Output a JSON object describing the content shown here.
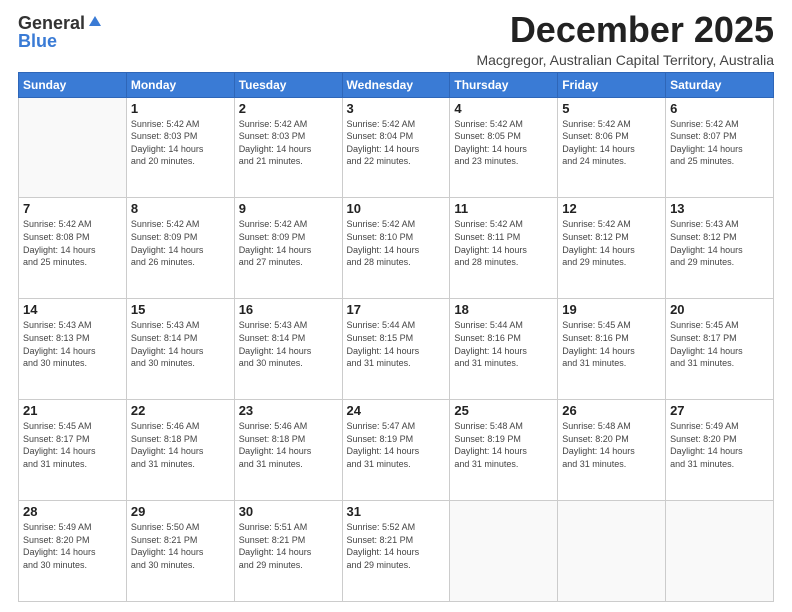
{
  "logo": {
    "general": "General",
    "blue": "Blue"
  },
  "title": "December 2025",
  "subtitle": "Macgregor, Australian Capital Territory, Australia",
  "days_header": [
    "Sunday",
    "Monday",
    "Tuesday",
    "Wednesday",
    "Thursday",
    "Friday",
    "Saturday"
  ],
  "weeks": [
    [
      {
        "num": "",
        "info": ""
      },
      {
        "num": "1",
        "info": "Sunrise: 5:42 AM\nSunset: 8:03 PM\nDaylight: 14 hours\nand 20 minutes."
      },
      {
        "num": "2",
        "info": "Sunrise: 5:42 AM\nSunset: 8:03 PM\nDaylight: 14 hours\nand 21 minutes."
      },
      {
        "num": "3",
        "info": "Sunrise: 5:42 AM\nSunset: 8:04 PM\nDaylight: 14 hours\nand 22 minutes."
      },
      {
        "num": "4",
        "info": "Sunrise: 5:42 AM\nSunset: 8:05 PM\nDaylight: 14 hours\nand 23 minutes."
      },
      {
        "num": "5",
        "info": "Sunrise: 5:42 AM\nSunset: 8:06 PM\nDaylight: 14 hours\nand 24 minutes."
      },
      {
        "num": "6",
        "info": "Sunrise: 5:42 AM\nSunset: 8:07 PM\nDaylight: 14 hours\nand 25 minutes."
      }
    ],
    [
      {
        "num": "7",
        "info": "Sunrise: 5:42 AM\nSunset: 8:08 PM\nDaylight: 14 hours\nand 25 minutes."
      },
      {
        "num": "8",
        "info": "Sunrise: 5:42 AM\nSunset: 8:09 PM\nDaylight: 14 hours\nand 26 minutes."
      },
      {
        "num": "9",
        "info": "Sunrise: 5:42 AM\nSunset: 8:09 PM\nDaylight: 14 hours\nand 27 minutes."
      },
      {
        "num": "10",
        "info": "Sunrise: 5:42 AM\nSunset: 8:10 PM\nDaylight: 14 hours\nand 28 minutes."
      },
      {
        "num": "11",
        "info": "Sunrise: 5:42 AM\nSunset: 8:11 PM\nDaylight: 14 hours\nand 28 minutes."
      },
      {
        "num": "12",
        "info": "Sunrise: 5:42 AM\nSunset: 8:12 PM\nDaylight: 14 hours\nand 29 minutes."
      },
      {
        "num": "13",
        "info": "Sunrise: 5:43 AM\nSunset: 8:12 PM\nDaylight: 14 hours\nand 29 minutes."
      }
    ],
    [
      {
        "num": "14",
        "info": "Sunrise: 5:43 AM\nSunset: 8:13 PM\nDaylight: 14 hours\nand 30 minutes."
      },
      {
        "num": "15",
        "info": "Sunrise: 5:43 AM\nSunset: 8:14 PM\nDaylight: 14 hours\nand 30 minutes."
      },
      {
        "num": "16",
        "info": "Sunrise: 5:43 AM\nSunset: 8:14 PM\nDaylight: 14 hours\nand 30 minutes."
      },
      {
        "num": "17",
        "info": "Sunrise: 5:44 AM\nSunset: 8:15 PM\nDaylight: 14 hours\nand 31 minutes."
      },
      {
        "num": "18",
        "info": "Sunrise: 5:44 AM\nSunset: 8:16 PM\nDaylight: 14 hours\nand 31 minutes."
      },
      {
        "num": "19",
        "info": "Sunrise: 5:45 AM\nSunset: 8:16 PM\nDaylight: 14 hours\nand 31 minutes."
      },
      {
        "num": "20",
        "info": "Sunrise: 5:45 AM\nSunset: 8:17 PM\nDaylight: 14 hours\nand 31 minutes."
      }
    ],
    [
      {
        "num": "21",
        "info": "Sunrise: 5:45 AM\nSunset: 8:17 PM\nDaylight: 14 hours\nand 31 minutes."
      },
      {
        "num": "22",
        "info": "Sunrise: 5:46 AM\nSunset: 8:18 PM\nDaylight: 14 hours\nand 31 minutes."
      },
      {
        "num": "23",
        "info": "Sunrise: 5:46 AM\nSunset: 8:18 PM\nDaylight: 14 hours\nand 31 minutes."
      },
      {
        "num": "24",
        "info": "Sunrise: 5:47 AM\nSunset: 8:19 PM\nDaylight: 14 hours\nand 31 minutes."
      },
      {
        "num": "25",
        "info": "Sunrise: 5:48 AM\nSunset: 8:19 PM\nDaylight: 14 hours\nand 31 minutes."
      },
      {
        "num": "26",
        "info": "Sunrise: 5:48 AM\nSunset: 8:20 PM\nDaylight: 14 hours\nand 31 minutes."
      },
      {
        "num": "27",
        "info": "Sunrise: 5:49 AM\nSunset: 8:20 PM\nDaylight: 14 hours\nand 31 minutes."
      }
    ],
    [
      {
        "num": "28",
        "info": "Sunrise: 5:49 AM\nSunset: 8:20 PM\nDaylight: 14 hours\nand 30 minutes."
      },
      {
        "num": "29",
        "info": "Sunrise: 5:50 AM\nSunset: 8:21 PM\nDaylight: 14 hours\nand 30 minutes."
      },
      {
        "num": "30",
        "info": "Sunrise: 5:51 AM\nSunset: 8:21 PM\nDaylight: 14 hours\nand 29 minutes."
      },
      {
        "num": "31",
        "info": "Sunrise: 5:52 AM\nSunset: 8:21 PM\nDaylight: 14 hours\nand 29 minutes."
      },
      {
        "num": "",
        "info": ""
      },
      {
        "num": "",
        "info": ""
      },
      {
        "num": "",
        "info": ""
      }
    ]
  ]
}
